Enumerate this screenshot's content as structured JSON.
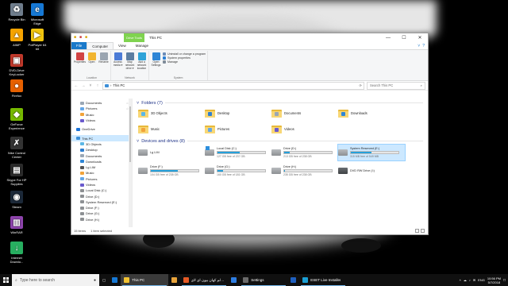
{
  "desktop": {
    "icons": [
      {
        "label": "Recycle Bin",
        "glyph": "♻",
        "color": "#6f7d8c"
      },
      {
        "label": "Microsoft\nEdge",
        "glyph": "e",
        "color": "#1678d4"
      },
      {
        "label": "AIMP",
        "glyph": "▲",
        "color": "#f5a300"
      },
      {
        "label": "PotPlayer 64\nbit",
        "glyph": "▶",
        "color": "#f1c40f"
      },
      {
        "label": "DVD-Drive\nKeyLocker",
        "glyph": "▣",
        "color": "#c0392b"
      },
      {
        "label": "Firefox",
        "glyph": "●",
        "color": "#e66000"
      },
      {
        "label": "GeForce\nExperience",
        "glyph": "◆",
        "color": "#76b900"
      },
      {
        "label": "Nike Control\nCenter",
        "glyph": "✗",
        "color": "#333333"
      },
      {
        "label": "Skype For HP\nSupplies",
        "glyph": "▤",
        "color": "#2b2b2b"
      },
      {
        "label": "Steam",
        "glyph": "◉",
        "color": "#1b2838"
      },
      {
        "label": "WinRAR",
        "glyph": "▥",
        "color": "#8e44ad"
      },
      {
        "label": "Internet\nDownlo...",
        "glyph": "↓",
        "color": "#27ae60"
      }
    ]
  },
  "window": {
    "title": "This PC",
    "drive_tools_label": "Drive Tools",
    "controls": {
      "minimize": "—",
      "maximize": "☐",
      "close": "✕"
    },
    "tabs": [
      {
        "label": "File",
        "kind": "file"
      },
      {
        "label": "Computer",
        "kind": "active"
      },
      {
        "label": "View",
        "kind": "normal"
      },
      {
        "label": "Manage",
        "kind": "normal"
      }
    ],
    "ribbon": {
      "groups": [
        {
          "label": "Location",
          "commands": [
            {
              "label": "Properties",
              "color": "#d14343"
            },
            {
              "label": "Open",
              "color": "#f1b531"
            },
            {
              "label": "Rename",
              "color": "#9aa5b1"
            }
          ]
        },
        {
          "label": "Network",
          "commands": [
            {
              "label": "Access media ▾",
              "color": "#4b7bd6"
            },
            {
              "label": "Map network drive ▾",
              "color": "#5b7da1"
            },
            {
              "label": "Add a network location",
              "color": "#2fa3d8"
            }
          ]
        },
        {
          "label": "System",
          "commands": [
            {
              "label": "Open Settings",
              "color": "#2f86d6"
            }
          ],
          "list": [
            {
              "label": "Uninstall or change a program",
              "color": "#6b8cb8"
            },
            {
              "label": "System properties",
              "color": "#2b7fd4"
            },
            {
              "label": "Manage",
              "color": "#7f8c9a"
            }
          ]
        }
      ]
    },
    "address": {
      "back": "←",
      "forward": "→",
      "recent": "˅",
      "up": "↑",
      "path": "This PC",
      "refresh": "⟳",
      "search_placeholder": "Search This PC",
      "search_icon": "⌕"
    },
    "nav": {
      "items": [
        {
          "label": "Documents",
          "color": "#9aa7b5",
          "pinned": true,
          "level": 1
        },
        {
          "label": "Pictures",
          "color": "#64a7e8",
          "pinned": true,
          "level": 1
        },
        {
          "label": "Music",
          "color": "#f1a33a",
          "pinned": false,
          "level": 1
        },
        {
          "label": "Videos",
          "color": "#6a5acd",
          "pinned": false,
          "level": 1
        },
        {
          "gap": true
        },
        {
          "label": "OneDrive",
          "color": "#1a73d8",
          "pinned": false,
          "level": 0
        },
        {
          "gap": true
        },
        {
          "label": "This PC",
          "color": "#3c8fd8",
          "pinned": false,
          "level": 0,
          "selected": true
        },
        {
          "label": "3D Objects",
          "color": "#5bb7e6",
          "pinned": false,
          "level": 1
        },
        {
          "label": "Desktop",
          "color": "#2f7fd0",
          "pinned": false,
          "level": 1
        },
        {
          "label": "Documents",
          "color": "#9aa7b5",
          "pinned": false,
          "level": 1
        },
        {
          "label": "Downloads",
          "color": "#2f86d6",
          "pinned": false,
          "level": 1
        },
        {
          "label": "Lg LIM",
          "color": "#555555",
          "pinned": false,
          "level": 1
        },
        {
          "label": "Music",
          "color": "#f1a33a",
          "pinned": false,
          "level": 1
        },
        {
          "label": "Pictures",
          "color": "#64a7e8",
          "pinned": false,
          "level": 1
        },
        {
          "label": "Videos",
          "color": "#6a5acd",
          "pinned": false,
          "level": 1
        },
        {
          "label": "Local Disk (C:)",
          "color": "#8d9093",
          "pinned": false,
          "level": 1
        },
        {
          "label": "Drive (D:)",
          "color": "#8d9093",
          "pinned": false,
          "level": 1
        },
        {
          "label": "System Reserved (E:)",
          "color": "#8d9093",
          "pinned": false,
          "level": 1
        },
        {
          "label": "Drive (F:)",
          "color": "#8d9093",
          "pinned": false,
          "level": 1
        },
        {
          "label": "Drive (G:)",
          "color": "#8d9093",
          "pinned": false,
          "level": 1
        },
        {
          "label": "Drive (H:)",
          "color": "#8d9093",
          "pinned": false,
          "level": 1
        },
        {
          "gap": true
        },
        {
          "label": "Network",
          "color": "#3c8fd8",
          "pinned": false,
          "level": 0
        }
      ],
      "pin_glyph": "☆"
    },
    "folders_header": "Folders (7)",
    "folders": [
      {
        "name": "3D Objects",
        "badge": "#5bb7e6"
      },
      {
        "name": "Desktop",
        "badge": "#2f7fd0"
      },
      {
        "name": "Documents",
        "badge": "#9aa7b5"
      },
      {
        "name": "Downloads",
        "badge": "#2f86d6"
      },
      {
        "name": "Music",
        "badge": "#f1a33a"
      },
      {
        "name": "Pictures",
        "badge": "#64a7e8"
      },
      {
        "name": "Videos",
        "badge": "#6a5acd"
      }
    ],
    "drives_header": "Devices and drives (8)",
    "drives": [
      {
        "name": "Lg LIM",
        "type": "device",
        "free": "",
        "used_fraction": null
      },
      {
        "name": "Local Disk (C:)",
        "type": "system",
        "free": "127 GB free of 237 GB",
        "used_fraction": 0.46
      },
      {
        "name": "Drive (D:)",
        "type": "disk",
        "free": "213 GB free of 238 GB",
        "used_fraction": 0.11
      },
      {
        "name": "System Reserved (E:)",
        "type": "disk",
        "free": "315 MB free of 549 MB",
        "used_fraction": 0.43,
        "selected": true
      },
      {
        "name": "Drive (F:)",
        "type": "disk",
        "free": "104 GB free of 238 GB",
        "used_fraction": 0.56
      },
      {
        "name": "Drive (G:)",
        "type": "disk",
        "free": "160 GB free of 181 GB",
        "used_fraction": 0.12
      },
      {
        "name": "Drive (H:)",
        "type": "disk",
        "free": "235 GB free of 238 GB",
        "used_fraction": 0.01
      },
      {
        "name": "DVD RW Drive (I:)",
        "type": "dvd",
        "free": "",
        "used_fraction": null
      }
    ],
    "status": {
      "items": "15 items",
      "selected": "1 item selected"
    }
  },
  "taskbar": {
    "search_placeholder": "Type here to search",
    "search_icon": "⌕",
    "mic_icon": "●",
    "task_view_icon": "▢",
    "apps": [
      {
        "label": "",
        "color": "#1678d4",
        "kind": "edge"
      },
      {
        "label": "This PC",
        "color": "#f1c232",
        "kind": "explorer",
        "active": true
      },
      {
        "label": "",
        "color": "#e8a33a",
        "kind": "folder"
      },
      {
        "label": "مکالم کهان بیون ای لای...",
        "color": "#e55a25",
        "kind": "chrome",
        "open": true
      },
      {
        "label": "",
        "color": "#2e7de1",
        "kind": "teams"
      },
      {
        "label": "Settings",
        "color": "#6a6a6a",
        "kind": "settings",
        "open": true
      },
      {
        "label": "",
        "color": "#1f5fbf",
        "kind": "app"
      },
      {
        "label": "ESET Live Installer",
        "color": "#1a9fd4",
        "kind": "eset",
        "open": true
      }
    ],
    "tray": {
      "icons": [
        "˄",
        "☁",
        "♪",
        "✉"
      ],
      "lang": "ENG",
      "time": "10:56 PM",
      "date": "5/7/2018",
      "notif": "□"
    }
  }
}
